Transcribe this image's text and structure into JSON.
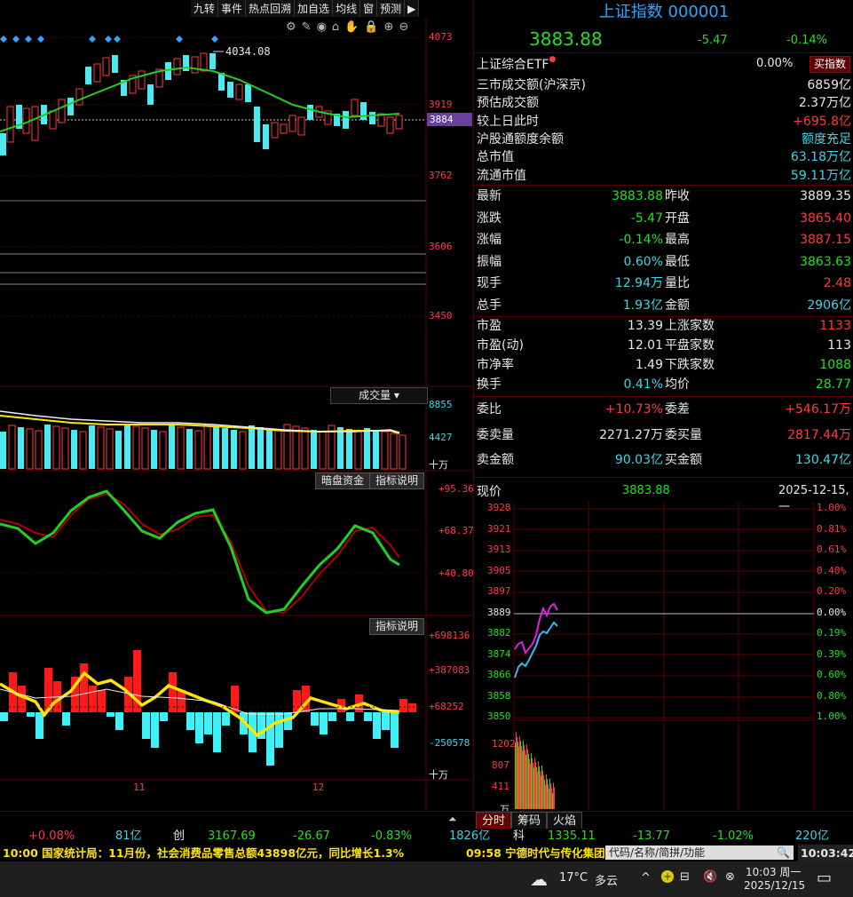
{
  "toolbar": {
    "items": [
      "九转",
      "事件",
      "热点回溯",
      "加自选",
      "均线",
      "窗",
      "预测"
    ]
  },
  "price_axis": {
    "labels": [
      "4073",
      "3919",
      "3884",
      "3762",
      "3606",
      "3450"
    ],
    "current": "3884",
    "high_note": "4034.08"
  },
  "volume_panel": {
    "title": "成交量",
    "axis": [
      "8855",
      "4427",
      "十万"
    ]
  },
  "osc_panel": {
    "btn1": "暗盘资金",
    "btn2": "指标说明",
    "axis": [
      "+95.36",
      "+68.37",
      "+40.80"
    ]
  },
  "macd_panel": {
    "btn": "指标说明",
    "axis": [
      "+698136",
      "+387083",
      "+68252",
      "-250578",
      "十万"
    ]
  },
  "date_axis": {
    "labels": [
      "11",
      "12"
    ]
  },
  "quote": {
    "title": "上证指数 000001",
    "price": "3883.88",
    "change": "-5.47",
    "pct": "-0.14%",
    "etf_name": "上证综合ETF",
    "etf_pct": "0.00%",
    "etf_btn": "买指数",
    "rows1": [
      {
        "k": "三市成交额(沪深京)",
        "v": "6859亿"
      },
      {
        "k": "预估成交额",
        "v": "2.37万亿"
      },
      {
        "k": "较上日此时",
        "v": "+695.8亿"
      },
      {
        "k": "沪股通额度余额",
        "v": "额度充足"
      },
      {
        "k": "总市值",
        "v": "63.18万亿"
      },
      {
        "k": "流通市值",
        "v": "59.11万亿"
      }
    ],
    "rows2": [
      {
        "k1": "最新",
        "v1": "3883.88",
        "k2": "昨收",
        "v2": "3889.35"
      },
      {
        "k1": "涨跌",
        "v1": "-5.47",
        "k2": "开盘",
        "v2": "3865.40"
      },
      {
        "k1": "涨幅",
        "v1": "-0.14%",
        "k2": "最高",
        "v2": "3887.15"
      },
      {
        "k1": "振幅",
        "v1": "0.60%",
        "k2": "最低",
        "v2": "3863.63"
      },
      {
        "k1": "现手",
        "v1": "12.94万",
        "k2": "量比",
        "v2": "2.48"
      },
      {
        "k1": "总手",
        "v1": "1.93亿",
        "k2": "金额",
        "v2": "2906亿"
      }
    ],
    "rows3": [
      {
        "k1": "市盈",
        "v1": "13.39",
        "k2": "上涨家数",
        "v2": "1133"
      },
      {
        "k1": "市盈(动)",
        "v1": "12.01",
        "k2": "平盘家数",
        "v2": "113"
      },
      {
        "k1": "市净率",
        "v1": "1.49",
        "k2": "下跌家数",
        "v2": "1088"
      },
      {
        "k1": "换手",
        "v1": "0.41%",
        "k2": "均价",
        "v2": "28.77"
      }
    ],
    "rows4": [
      {
        "k1": "委比",
        "v1": "+10.73%",
        "k2": "委差",
        "v2": "+546.17万"
      },
      {
        "k1": "委卖量",
        "v1": "2271.27万",
        "k2": "委买量",
        "v2": "2817.44万"
      },
      {
        "k1": "卖金额",
        "v1": "90.03亿",
        "k2": "买金额",
        "v2": "130.47亿"
      }
    ]
  },
  "intraday": {
    "label": "现价",
    "price": "3883.88",
    "date": "2025-12-15,一",
    "left_axis": [
      "3928",
      "3921",
      "3913",
      "3905",
      "3897",
      "3889",
      "3882",
      "3874",
      "3866",
      "3858",
      "3850"
    ],
    "right_axis": [
      "1.00%",
      "0.81%",
      "0.61%",
      "0.40%",
      "0.20%",
      "0.00%",
      "0.19%",
      "0.39%",
      "0.60%",
      "0.80%",
      "1.00%"
    ],
    "vol_axis": [
      "1202",
      "807",
      "411",
      "万"
    ]
  },
  "bottom_tabs": [
    "分时",
    "筹码",
    "火焰"
  ],
  "status": {
    "s1": "+0.08%",
    "s2": "81亿",
    "s3": "创",
    "s4": "3167.69",
    "s5": "-26.67",
    "s6": "-0.83%",
    "s7": "1826亿",
    "s8": "科",
    "s9": "1335.11",
    "s10": "-13.77",
    "s11": "-1.02%",
    "s12": "220亿"
  },
  "news": {
    "left": "10:00 国家统计局：11月份，社会消费品零售总额43898亿元，同比增长1.3%",
    "right": "09:58 宁德时代与传化集团",
    "search_placeholder": "代码/名称/简拼/功能",
    "clock": "10:03:42"
  },
  "taskbar": {
    "weather": "17°C",
    "weather_text": "多云",
    "time": "10:03 周一",
    "date": "2025/12/15"
  },
  "colors": {
    "up": "#ff3b3b",
    "down": "#22e022",
    "accent": "#2ea8ff"
  },
  "chart_data": [
    {
      "type": "candlestick",
      "title": "",
      "ylabel_ticks": [
        4073,
        3919,
        3762,
        3606,
        3450
      ],
      "last": 3884
    },
    {
      "type": "line",
      "title": "分时",
      "x": [
        "09:30",
        "10:03"
      ],
      "ylim": [
        3850,
        3928
      ],
      "prev_close": 3889.35,
      "last": 3883.88
    }
  ]
}
